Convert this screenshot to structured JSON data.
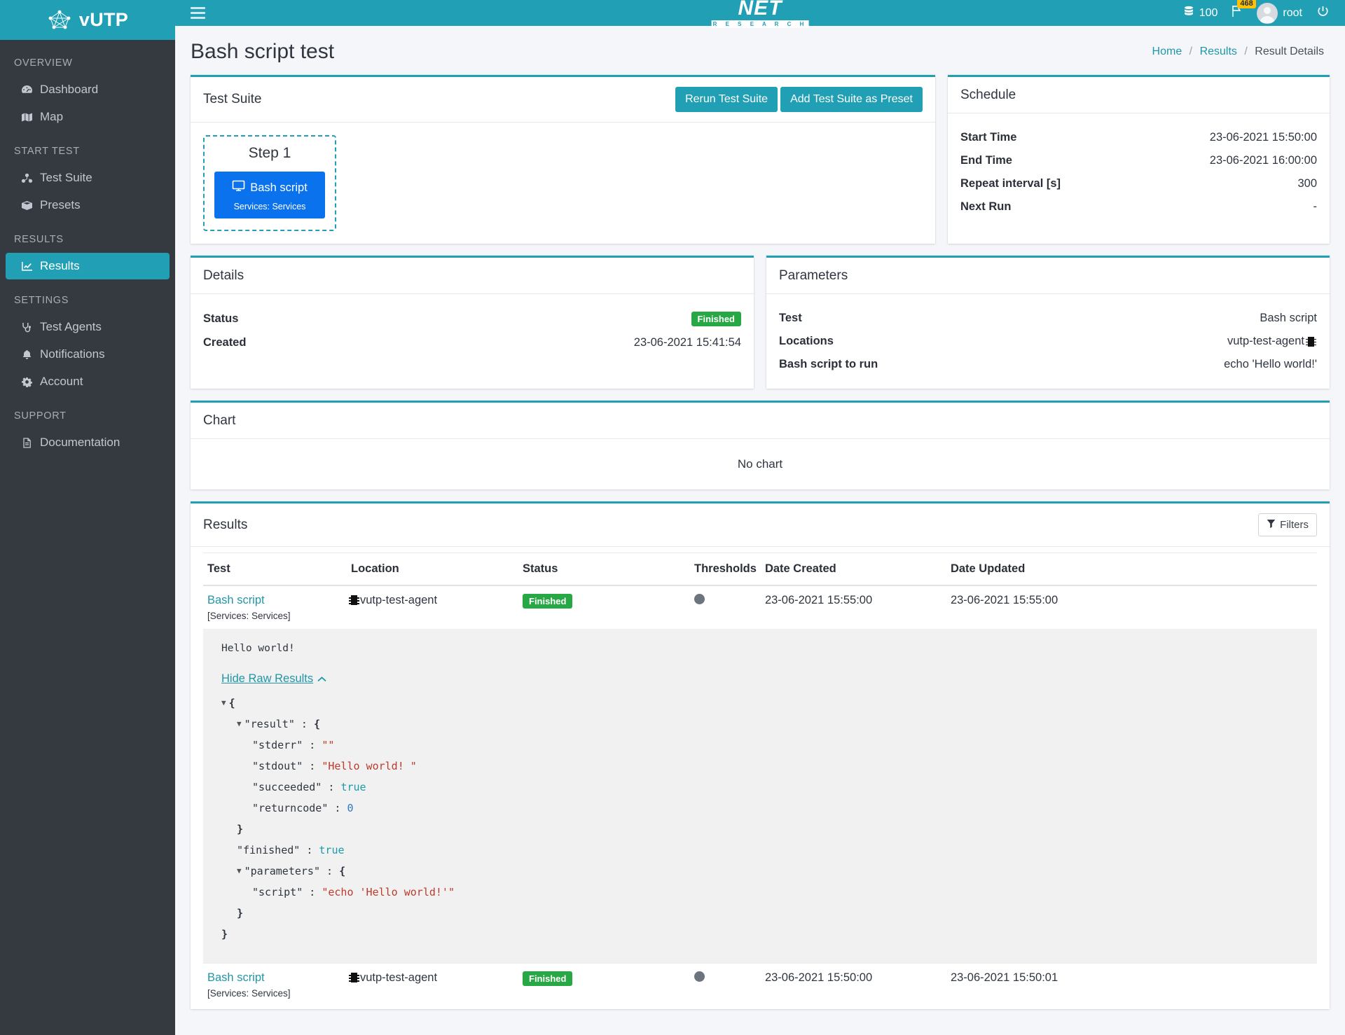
{
  "brand": {
    "name": "vUTP",
    "logo_icon": "network-graph-icon"
  },
  "topbar": {
    "menu_icon": "hamburger-icon",
    "center_logo_main": "NET",
    "center_logo_sub": "R E S E A R C H",
    "credits_icon": "database-icon",
    "credits": "100",
    "flag_icon": "flag-icon",
    "flag_badge": "468",
    "avatar_icon": "user-avatar-icon",
    "user": "root",
    "power_icon": "power-icon"
  },
  "sidebar": {
    "sections": [
      {
        "title": "OVERVIEW",
        "items": [
          {
            "label": "Dashboard",
            "icon": "dashboard-icon",
            "active": false
          },
          {
            "label": "Map",
            "icon": "map-icon",
            "active": false
          }
        ]
      },
      {
        "title": "START TEST",
        "items": [
          {
            "label": "Test Suite",
            "icon": "test-suite-icon",
            "active": false
          },
          {
            "label": "Presets",
            "icon": "box-icon",
            "active": false
          }
        ]
      },
      {
        "title": "RESULTS",
        "items": [
          {
            "label": "Results",
            "icon": "chart-line-icon",
            "active": true
          }
        ]
      },
      {
        "title": "SETTINGS",
        "items": [
          {
            "label": "Test Agents",
            "icon": "stethoscope-icon",
            "active": false
          },
          {
            "label": "Notifications",
            "icon": "bell-icon",
            "active": false
          },
          {
            "label": "Account",
            "icon": "gear-icon",
            "active": false
          }
        ]
      },
      {
        "title": "SUPPORT",
        "items": [
          {
            "label": "Documentation",
            "icon": "file-icon",
            "active": false
          }
        ]
      }
    ]
  },
  "page": {
    "title": "Bash script test",
    "breadcrumb": [
      "Home",
      "Results",
      "Result Details"
    ]
  },
  "test_suite": {
    "title": "Test Suite",
    "rerun_label": "Rerun Test Suite",
    "add_preset_label": "Add Test Suite as Preset",
    "step": {
      "label": "Step 1",
      "tile_title": "Bash script",
      "tile_icon": "monitor-icon",
      "tile_sub": "Services: Services"
    }
  },
  "schedule": {
    "title": "Schedule",
    "rows": [
      {
        "key": "Start Time",
        "value": "23-06-2021 15:50:00"
      },
      {
        "key": "End Time",
        "value": "23-06-2021 16:00:00"
      },
      {
        "key": "Repeat interval [s]",
        "value": "300"
      },
      {
        "key": "Next Run",
        "value": "-"
      }
    ]
  },
  "details": {
    "title": "Details",
    "status_key": "Status",
    "status_value": "Finished",
    "created_key": "Created",
    "created_value": "23-06-2021 15:41:54"
  },
  "parameters": {
    "title": "Parameters",
    "rows": [
      {
        "key": "Test",
        "value": "Bash script"
      },
      {
        "key": "Locations",
        "value": "vutp-test-agent",
        "icon": "chip-icon"
      },
      {
        "key": "Bash script to run",
        "value": "echo 'Hello world!'"
      }
    ]
  },
  "chart": {
    "title": "Chart",
    "empty_text": "No chart"
  },
  "results": {
    "title": "Results",
    "filters_label": "Filters",
    "filter_icon": "funnel-icon",
    "columns": [
      "Test",
      "Location",
      "Status",
      "Thresholds",
      "Date Created",
      "Date Updated"
    ],
    "rows": [
      {
        "test": "Bash script",
        "test_sub": "[Services: Services]",
        "location": "vutp-test-agent",
        "status": "Finished",
        "date_created": "23-06-2021 15:55:00",
        "date_updated": "23-06-2021 15:55:00"
      },
      {
        "test": "Bash script",
        "test_sub": "[Services: Services]",
        "location": "vutp-test-agent",
        "status": "Finished",
        "date_created": "23-06-2021 15:50:00",
        "date_updated": "23-06-2021 15:50:01"
      }
    ],
    "raw": {
      "stdout_preview": "Hello world!",
      "toggle_label": "Hide Raw Results",
      "lines": {
        "open_brace": "{",
        "result_key": "\"result\"",
        "stderr_key": "\"stderr\"",
        "stderr_val": "\"\"",
        "stdout_key": "\"stdout\"",
        "stdout_val": "\"Hello world! \"",
        "succeeded_key": "\"succeeded\"",
        "succeeded_val": "true",
        "returncode_key": "\"returncode\"",
        "returncode_val": "0",
        "close_inner": "}",
        "finished_key": "\"finished\"",
        "finished_val": "true",
        "parameters_key": "\"parameters\"",
        "script_key": "\"script\"",
        "script_val": "\"echo 'Hello world!'\"",
        "close_params": "}",
        "close_brace": "}"
      }
    }
  }
}
